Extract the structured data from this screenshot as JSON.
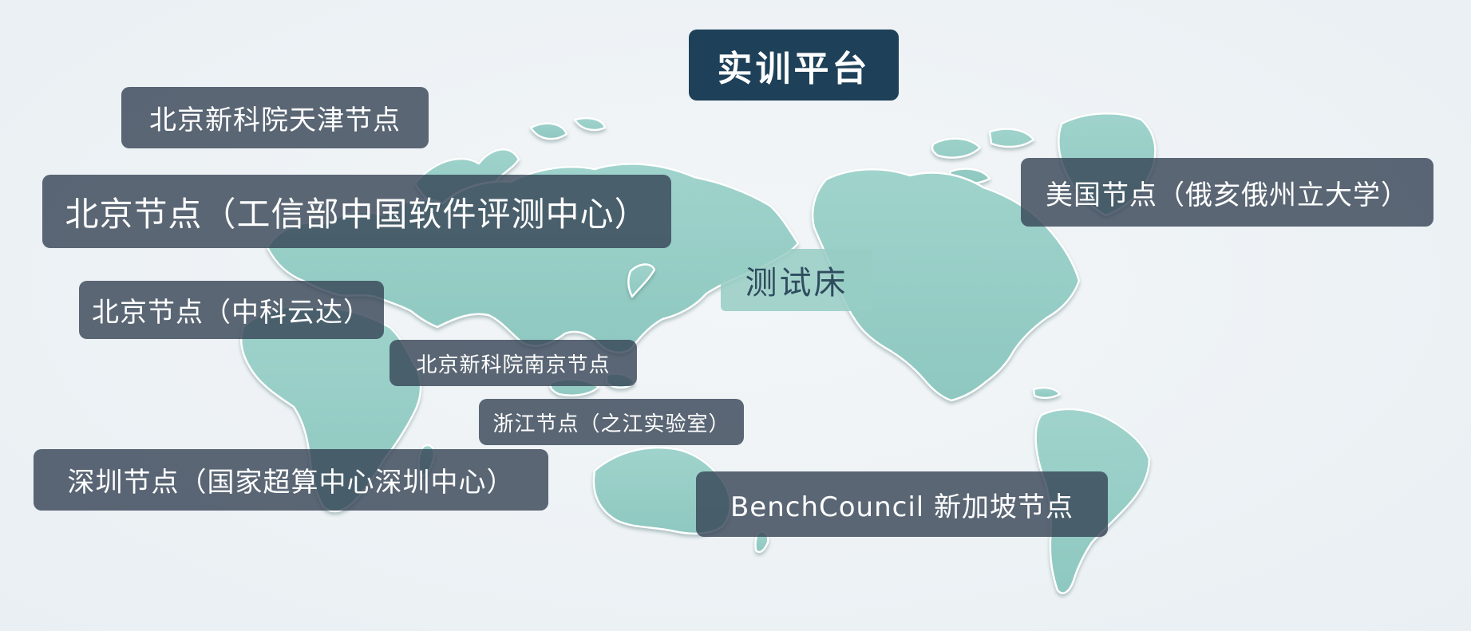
{
  "platform": {
    "label": "实训平台"
  },
  "testbed": {
    "label": "测试床"
  },
  "nodes": {
    "tianjin": "北京新科院天津节点",
    "beijing_cesi": "北京节点（工信部中国软件评测中心）",
    "beijing_zkyd": "北京节点（中科云达）",
    "nanjing": "北京新科院南京节点",
    "zhejiang": "浙江节点（之江实验室）",
    "shenzhen": "深圳节点（国家超算中心深圳中心）",
    "singapore": "BenchCouncil 新加坡节点",
    "usa": "美国节点（俄亥俄州立大学）"
  },
  "colors": {
    "land": "#a6d6d0",
    "label_bg": "#344254",
    "platform_bg": "#1e4159",
    "testbed_bg": "#96cdc3"
  }
}
